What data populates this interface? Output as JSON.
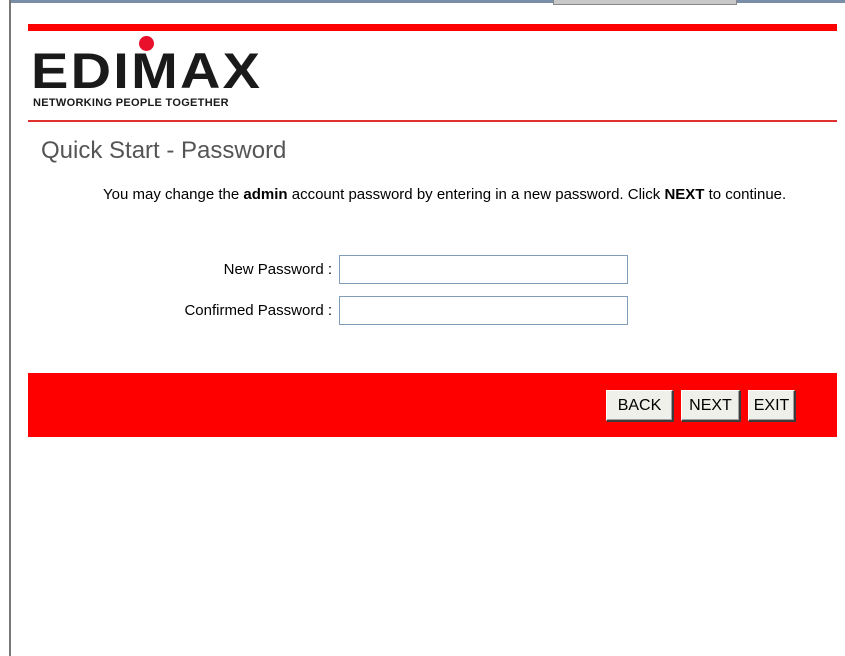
{
  "brand": {
    "name": "EDIMAX",
    "tagline": "NETWORKING PEOPLE TOGETHER",
    "accent_color": "#ff0000"
  },
  "page": {
    "title": "Quick Start - Password",
    "description": {
      "part1": "You may change the ",
      "bold1": "admin",
      "part2": " account password by entering in a new password. Click ",
      "bold2": "NEXT",
      "part3": " to continue."
    }
  },
  "form": {
    "new_password_label": "New Password :",
    "new_password_value": "",
    "confirm_password_label": "Confirmed Password :",
    "confirm_password_value": ""
  },
  "buttons": {
    "back": "BACK",
    "next": "NEXT",
    "exit": "EXIT"
  }
}
